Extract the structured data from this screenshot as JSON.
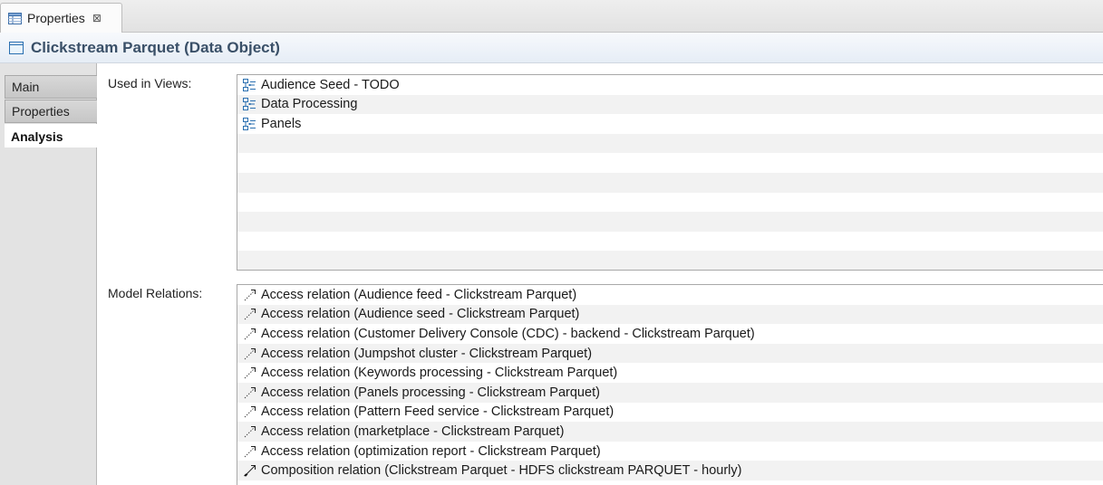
{
  "tab": {
    "label": "Properties",
    "close": "⊠"
  },
  "header": {
    "title": "Clickstream Parquet (Data Object)"
  },
  "sidebar": {
    "tabs": [
      {
        "label": "Main",
        "active": false
      },
      {
        "label": "Properties",
        "active": false
      },
      {
        "label": "Analysis",
        "active": true
      }
    ]
  },
  "views": {
    "label": "Used in Views:",
    "items": [
      {
        "label": "Audience Seed - TODO",
        "icon": "view-diagram-icon"
      },
      {
        "label": "Data Processing",
        "icon": "view-diagram-icon"
      },
      {
        "label": "Panels",
        "icon": "view-diagram-icon"
      }
    ],
    "empty_rows": 7
  },
  "relations": {
    "label": "Model Relations:",
    "items": [
      {
        "label": "Access relation (Audience feed - Clickstream Parquet)",
        "icon": "access-relation-icon"
      },
      {
        "label": "Access relation (Audience seed - Clickstream Parquet)",
        "icon": "access-relation-icon"
      },
      {
        "label": "Access relation (Customer Delivery Console (CDC) - backend - Clickstream Parquet)",
        "icon": "access-relation-icon"
      },
      {
        "label": "Access relation (Jumpshot cluster - Clickstream Parquet)",
        "icon": "access-relation-icon"
      },
      {
        "label": "Access relation (Keywords processing - Clickstream Parquet)",
        "icon": "access-relation-icon"
      },
      {
        "label": "Access relation (Panels processing - Clickstream Parquet)",
        "icon": "access-relation-icon"
      },
      {
        "label": "Access relation (Pattern Feed service - Clickstream Parquet)",
        "icon": "access-relation-icon"
      },
      {
        "label": "Access relation (marketplace - Clickstream Parquet)",
        "icon": "access-relation-icon"
      },
      {
        "label": "Access relation (optimization report - Clickstream Parquet)",
        "icon": "access-relation-icon"
      },
      {
        "label": "Composition relation (Clickstream Parquet - HDFS clickstream PARQUET - hourly)",
        "icon": "composition-relation-icon"
      }
    ]
  },
  "colors": {
    "title": "#3a5068",
    "object_icon": "#2a6fb0"
  }
}
